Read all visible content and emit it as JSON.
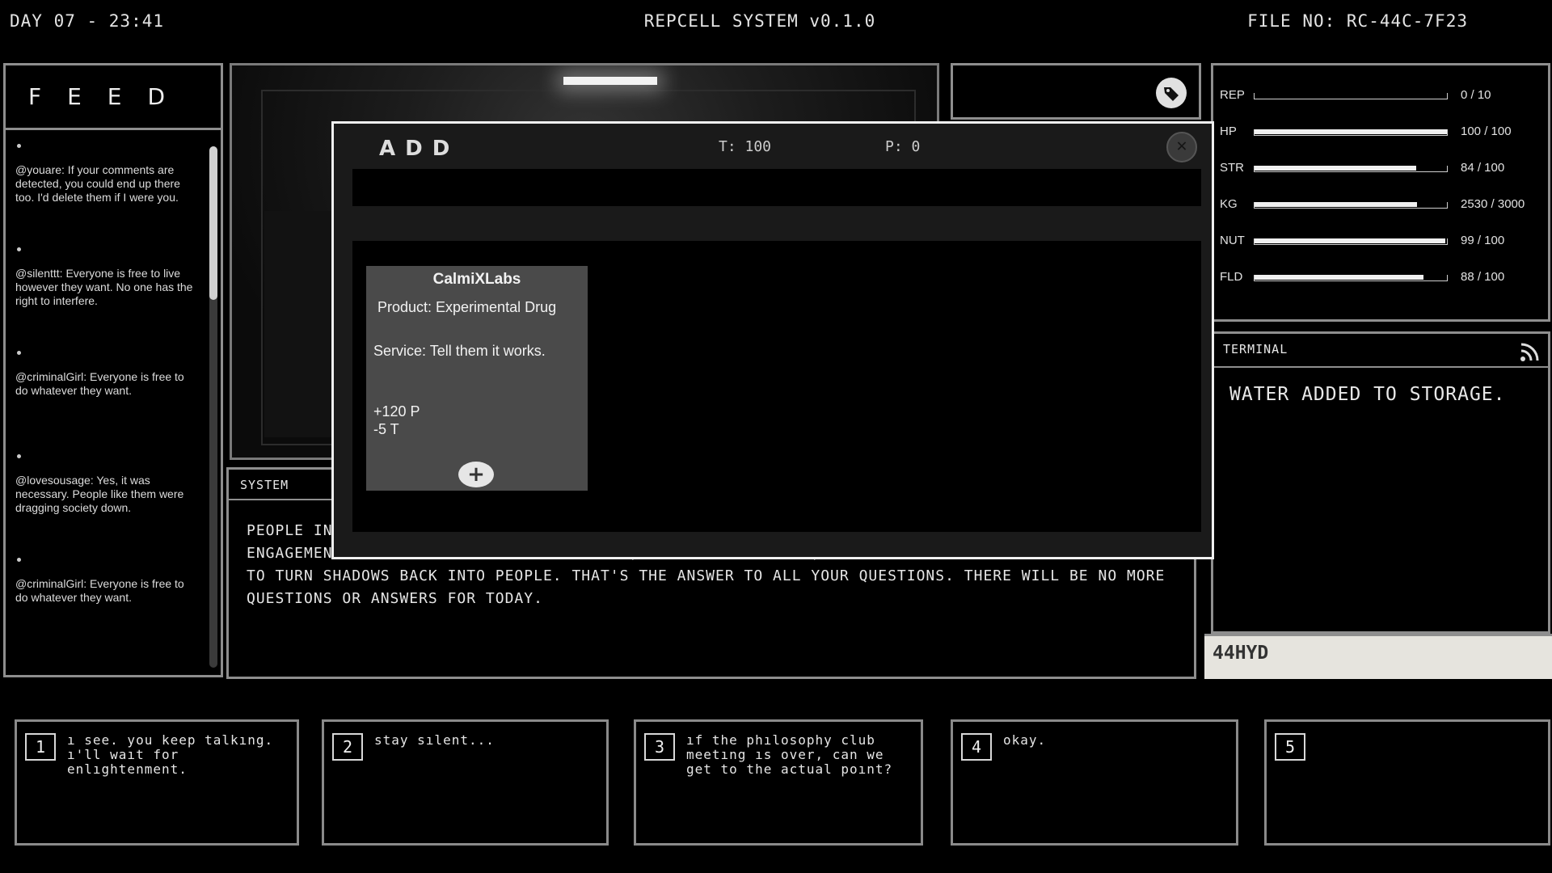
{
  "header": {
    "day_time": "DAY 07 - 23:41",
    "system_name": "REPCELL SYSTEM v0.1.0",
    "file_no": "FILE NO: RC-44C-7F23"
  },
  "feed": {
    "title": "FEED",
    "items": [
      {
        "text": "@youare: If your comments are detected, you could end up there too. I'd delete them if I were you."
      },
      {
        "text": "@silenttt: Everyone is free to live however they want. No one has the right to interfere."
      },
      {
        "text": "@criminalGirl: Everyone is free to do whatever they want."
      },
      {
        "text": "@lovesousage: Yes, it was necessary. People like them were dragging society down."
      },
      {
        "text": "@criminalGirl: Everyone is free to do whatever they want."
      }
    ]
  },
  "stats": [
    {
      "label": "REP",
      "value": "0 / 10",
      "fill": 0.0
    },
    {
      "label": "HP",
      "value": "100 / 100",
      "fill": 1.0
    },
    {
      "label": "STR",
      "value": "84 / 100",
      "fill": 0.84
    },
    {
      "label": "KG",
      "value": "2530 / 3000",
      "fill": 0.843
    },
    {
      "label": "NUT",
      "value": "99 / 100",
      "fill": 0.99
    },
    {
      "label": "FLD",
      "value": "88 / 100",
      "fill": 0.88
    }
  ],
  "terminal": {
    "title": "TERMINAL",
    "message": "WATER ADDED TO STORAGE.",
    "code": "44HYD"
  },
  "system": {
    "title": "SYSTEM",
    "text": "PEOPLE IN THIS WORLD HAVE ONLY ONE PURPOSE: THEY EITHER GIVE ENGAGEMENT OR RECEIVE IT. THE ENGAGEMENT ... LIVING SHADOW. THIS PLACE, ON THE OTHER HAND, IS A REHABILITATION SYSTEM DESIGNED TO TURN SHADOWS BACK INTO PEOPLE. THAT'S THE ANSWER TO ALL YOUR QUESTIONS. THERE WILL BE NO MORE QUESTIONS OR ANSWERS FOR TODAY."
  },
  "choices": [
    {
      "num": "1",
      "text": "ı see. you keep talkıng. ı'll waıt for enlıghtenment."
    },
    {
      "num": "2",
      "text": "stay sılent..."
    },
    {
      "num": "3",
      "text": "ıf the phılosophy club meetıng ıs over, can we get to the actual poınt?"
    },
    {
      "num": "4",
      "text": "okay."
    },
    {
      "num": "5",
      "text": ""
    }
  ],
  "add_modal": {
    "title": "ADD",
    "t_label": "T: 100",
    "p_label": "P: 0",
    "offer": {
      "brand": "CalmiXLabs",
      "product": "Product: Experimental Drug",
      "service": "Service: Tell them it works.",
      "p_change": "+120 P",
      "t_change": "-5 T",
      "add_symbol": "+"
    }
  },
  "icons": {
    "tag": "tag-icon",
    "rss": "rss-icon",
    "close": "close-icon",
    "add": "plus-icon"
  }
}
